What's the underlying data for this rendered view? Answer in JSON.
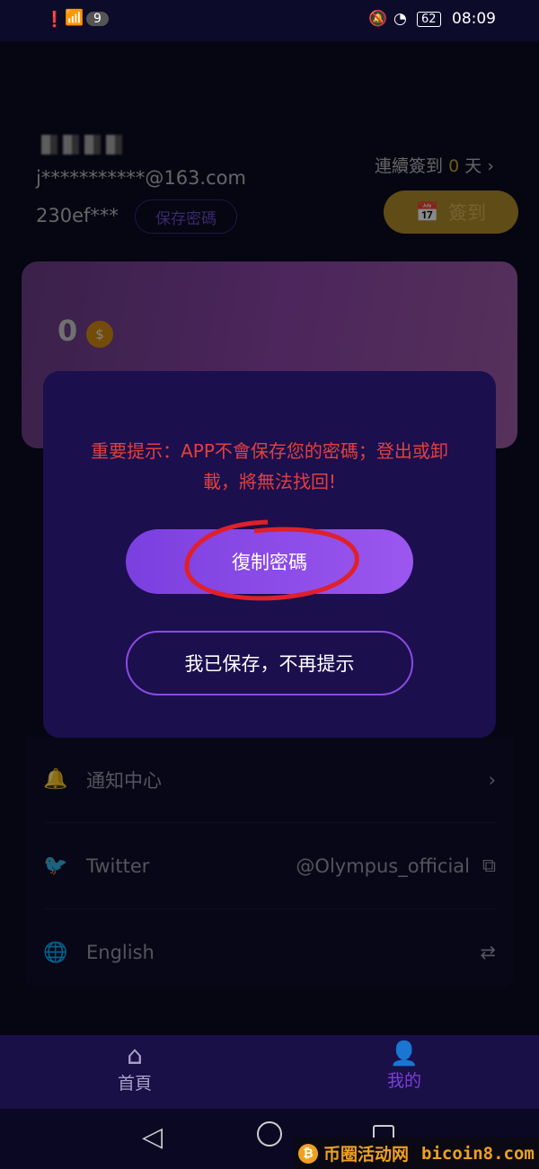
{
  "status_bar": {
    "notif_count": "9",
    "battery": "62",
    "time": "08:09"
  },
  "profile": {
    "email": "j***********@163.com",
    "password_masked": "230ef***",
    "save_password_label": "保存密碼",
    "streak_prefix": "連續簽到",
    "streak_days": "0",
    "streak_suffix": "天",
    "checkin_label": "簽到"
  },
  "balance": {
    "amount": "0",
    "coin_symbol": "$"
  },
  "menu": {
    "items": [
      {
        "label": "通知中心",
        "icon": "bell-icon"
      },
      {
        "label": "Twitter",
        "value": "@Olympus_official",
        "icon": "twitter-icon"
      },
      {
        "label": "English",
        "icon": "globe-icon"
      }
    ]
  },
  "modal": {
    "warning": "重要提示：APP不會保存您的密碼；登出或卸載，將無法找回!",
    "copy_label": "復制密碼",
    "dismiss_label": "我已保存，不再提示",
    "warning_color": "#e2403d",
    "accent": "#8a4be0"
  },
  "tabbar": {
    "tabs": [
      {
        "label": "首頁",
        "icon": "home-icon"
      },
      {
        "label": "我的",
        "icon": "user-icon",
        "active": true
      }
    ]
  },
  "watermark": {
    "text": "币圈活动网",
    "domain": "bicoin8.com"
  }
}
